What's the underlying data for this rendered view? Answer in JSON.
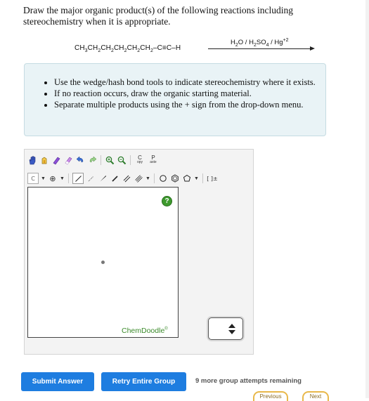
{
  "question": {
    "text": "Draw the major organic product(s) of the following reactions including stereochemistry when it is appropriate."
  },
  "reaction": {
    "reactant_parts": [
      "CH",
      "3",
      "CH",
      "2",
      "CH",
      "2",
      "CH",
      "2",
      "CH",
      "2",
      "CH",
      "2",
      "–C≡C–H"
    ],
    "reagent_parts": [
      "H",
      "2",
      "O / H",
      "2",
      "SO",
      "4",
      " / Hg",
      "+2"
    ]
  },
  "instructions": [
    "Use the wedge/hash bond tools to indicate stereochemistry where it exists.",
    "If no reaction occurs, draw the organic starting material.",
    "Separate multiple products using the + sign from the drop-down menu."
  ],
  "editor": {
    "toolbar_row1": [
      "hand-icon",
      "eraser-icon",
      "lasso-icon",
      "rubber-icon",
      "undo-icon",
      "redo-icon",
      "zoom-in-icon",
      "zoom-out-icon",
      "copy-icon",
      "paste-icon"
    ],
    "copy_label_top": "C",
    "copy_label_bottom": "opy",
    "paste_label_top": "P",
    "paste_label_bottom": "aste",
    "atom_label": "C",
    "charge_label": "⊕",
    "bracket_label": "[ ]±",
    "help_label": "?",
    "brand": "ChemDoodle",
    "brand_mark": "®"
  },
  "buttons": {
    "submit": "Submit Answer",
    "retry": "Retry Entire Group"
  },
  "status": {
    "attempts": "9 more group attempts remaining"
  },
  "nav": {
    "previous": "Previous",
    "next": "Next"
  },
  "colors": {
    "button_blue": "#1e7de0",
    "instructions_bg": "#e9f3f6",
    "chemdoodle_green": "#3a8a2a"
  }
}
